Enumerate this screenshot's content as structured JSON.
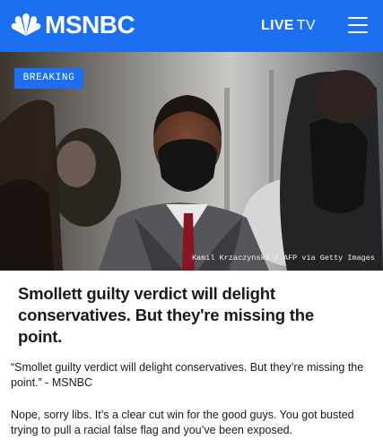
{
  "header": {
    "logo_text": "MSNBC",
    "live_label": "LIVE",
    "tv_label": "TV"
  },
  "hero": {
    "badge": "BREAKING",
    "credit": "Kamil Krzaczynski / AFP via Getty Images"
  },
  "article": {
    "headline": "Smollett guilty verdict will delight conservatives. But they're missing the point."
  },
  "post": {
    "quote": "“Smollet guilty verdict will delight conservatives. But they’re missing the point.” - MSNBC",
    "comment": "Nope, sorry libs. It’s a clear cut win for the good guys. You got busted trying to pull a racial false flag and you’ve been exposed."
  },
  "colors": {
    "brand_blue": "#1d6ff2",
    "text": "#1a1a1a"
  }
}
